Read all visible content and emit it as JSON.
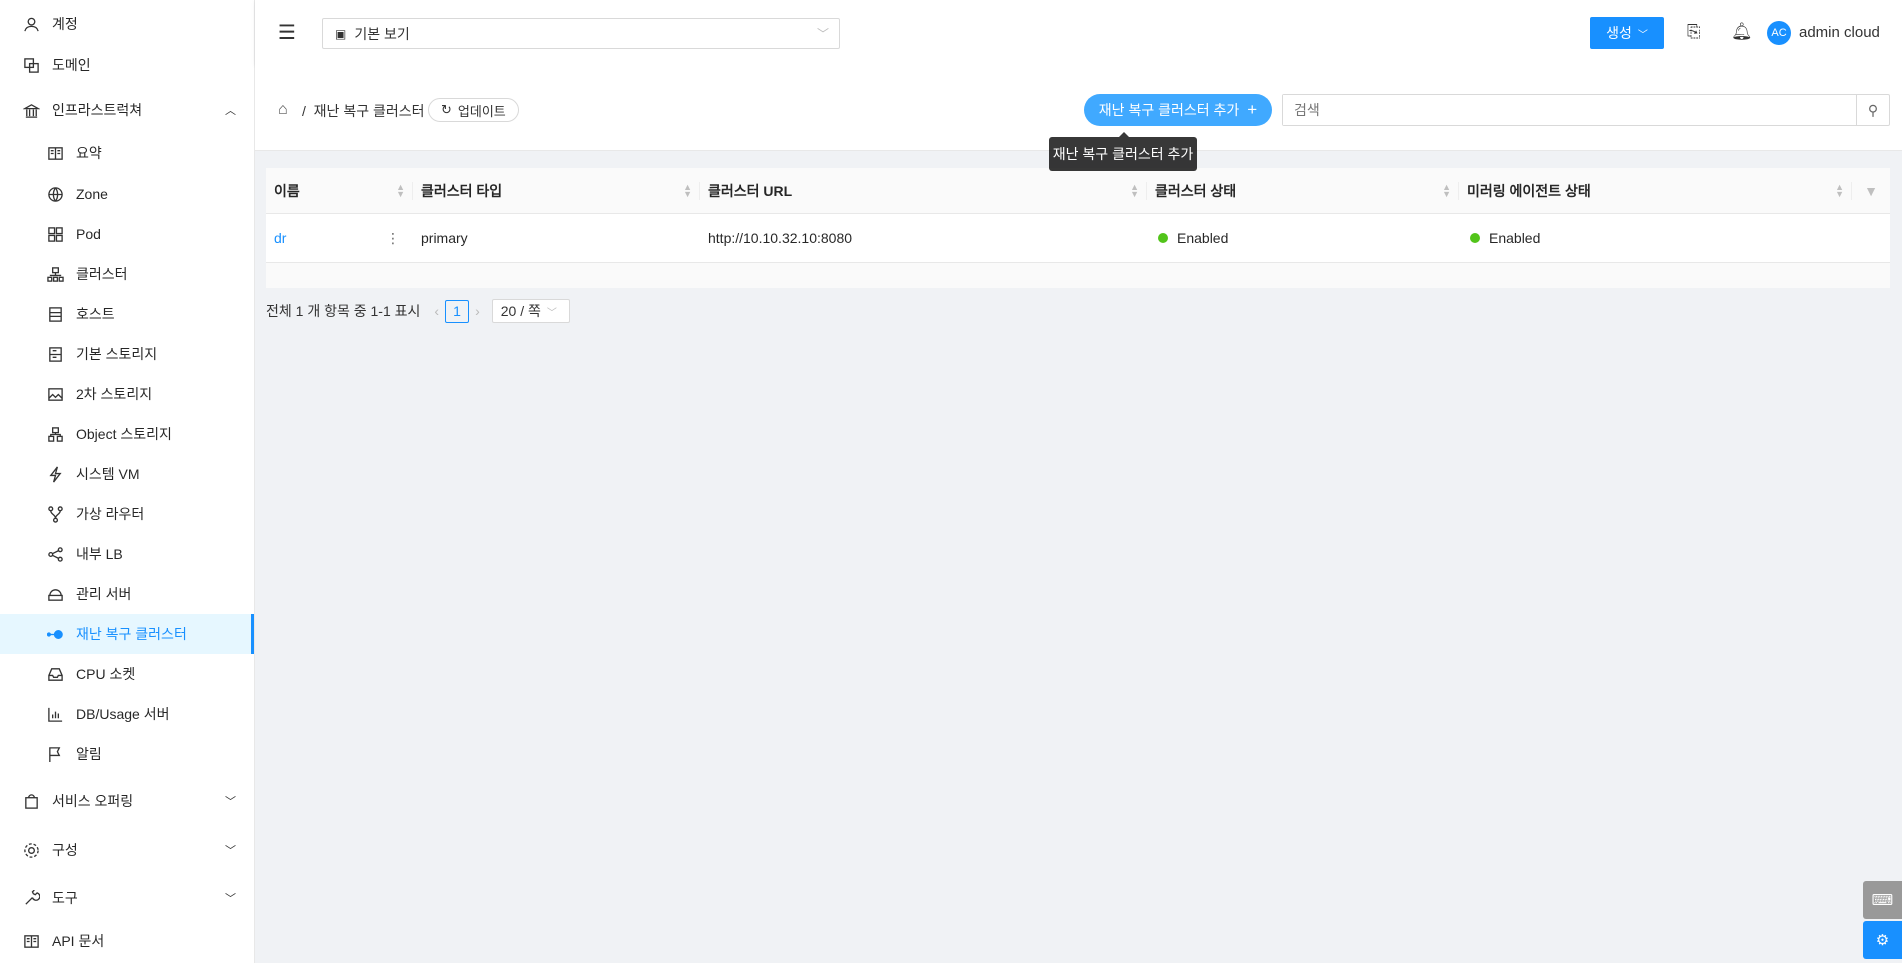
{
  "sidebar": {
    "items": [
      {
        "label": "계정",
        "icon": "user-icon"
      },
      {
        "label": "도메인",
        "icon": "domain-icon"
      },
      {
        "label": "인프라스트럭쳐",
        "icon": "bank-icon"
      },
      {
        "label": "요약",
        "icon": "book-icon"
      },
      {
        "label": "Zone",
        "icon": "globe-icon"
      },
      {
        "label": "Pod",
        "icon": "grid-icon"
      },
      {
        "label": "클러스터",
        "icon": "cluster-icon"
      },
      {
        "label": "호스트",
        "icon": "server-icon"
      },
      {
        "label": "기본 스토리지",
        "icon": "storage-icon"
      },
      {
        "label": "2차 스토리지",
        "icon": "picture-icon"
      },
      {
        "label": "Object 스토리지",
        "icon": "object-icon"
      },
      {
        "label": "시스템 VM",
        "icon": "thunder-icon"
      },
      {
        "label": "가상 라우터",
        "icon": "fork-icon"
      },
      {
        "label": "내부 LB",
        "icon": "share-icon"
      },
      {
        "label": "관리 서버",
        "icon": "management-icon"
      },
      {
        "label": "재난 복구 클러스터",
        "icon": "dr-icon"
      },
      {
        "label": "CPU 소켓",
        "icon": "inbox-icon"
      },
      {
        "label": "DB/Usage 서버",
        "icon": "chart-icon"
      },
      {
        "label": "알림",
        "icon": "flag-icon"
      },
      {
        "label": "서비스 오퍼링",
        "icon": "shopping-icon"
      },
      {
        "label": "구성",
        "icon": "gear-icon"
      },
      {
        "label": "도구",
        "icon": "tool-icon"
      },
      {
        "label": "API 문서",
        "icon": "read-icon"
      }
    ]
  },
  "header": {
    "view": "기본 보기",
    "create": "생성",
    "avatar": "AC",
    "user": "admin cloud"
  },
  "toolbar": {
    "breadcrumb": "재난 복구 클러스터",
    "refresh": "업데이트",
    "add": "재난 복구 클러스터 추가",
    "search_placeholder": "검색",
    "tooltip": "재난 복구 클러스터 추가"
  },
  "table": {
    "columns": [
      "이름",
      "클러스터 타입",
      "클러스터 URL",
      "클러스터 상태",
      "미러링 에이전트 상태"
    ],
    "rows": [
      {
        "name": "dr",
        "type": "primary",
        "url": "http://10.10.32.10:8080",
        "status": "Enabled",
        "mirror": "Enabled"
      }
    ]
  },
  "pager": {
    "summary": "전체 1 개 항목 중 1-1 표시",
    "page": "1",
    "size": "20 / 쪽"
  },
  "colors": {
    "primary": "#1890ff",
    "enabled": "#52c41a"
  }
}
